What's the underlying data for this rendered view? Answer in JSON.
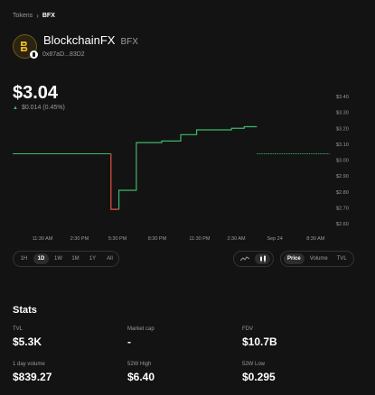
{
  "breadcrumb": {
    "parent": "Tokens",
    "separator": "›",
    "current": "BFX"
  },
  "token": {
    "name": "BlockchainFX",
    "symbol": "BFX",
    "address": "0x87aD...83D2",
    "logo_icon": "bfx-logo-icon"
  },
  "price": {
    "value": "$3.04",
    "change": "$0.014 (0.45%)",
    "direction": "up"
  },
  "chart_data": {
    "type": "line",
    "x_tick_labels": [
      "11:30 AM",
      "2:30 PM",
      "5:30 PM",
      "8:30 PM",
      "11:30 PM",
      "2:30 AM",
      "Sep 24",
      "8:30 AM"
    ],
    "y_tick_labels": [
      "$3.40",
      "$3.30",
      "$3.20",
      "$3.10",
      "$3.00",
      "$2.90",
      "$2.80",
      "$2.70",
      "$2.60"
    ],
    "ylim": [
      2.6,
      3.4
    ],
    "series": [
      {
        "values_by_index": "see points",
        "color": "#40b66b"
      }
    ],
    "points": [
      {
        "t": 0.0,
        "v": 3.04
      },
      {
        "t": 0.31,
        "v": 3.04
      },
      {
        "t": 0.31,
        "v": 2.69
      },
      {
        "t": 0.335,
        "v": 2.69
      },
      {
        "t": 0.335,
        "v": 2.81
      },
      {
        "t": 0.39,
        "v": 2.81
      },
      {
        "t": 0.39,
        "v": 3.11
      },
      {
        "t": 0.47,
        "v": 3.11
      },
      {
        "t": 0.47,
        "v": 3.12
      },
      {
        "t": 0.53,
        "v": 3.12
      },
      {
        "t": 0.53,
        "v": 3.16
      },
      {
        "t": 0.58,
        "v": 3.16
      },
      {
        "t": 0.58,
        "v": 3.19
      },
      {
        "t": 0.69,
        "v": 3.19
      },
      {
        "t": 0.69,
        "v": 3.2
      },
      {
        "t": 0.73,
        "v": 3.2
      },
      {
        "t": 0.73,
        "v": 3.21
      },
      {
        "t": 0.77,
        "v": 3.21
      }
    ],
    "dashed_segment": {
      "t_start": 0.77,
      "t_end": 1.0,
      "v": 3.04
    },
    "down_segment": {
      "t_start": 0.31,
      "t_end": 0.335,
      "color": "#e5533b"
    },
    "line_color": "#40b66b"
  },
  "time_ranges": [
    "1H",
    "1D",
    "1W",
    "1M",
    "1Y",
    "All"
  ],
  "time_range_selected": "1D",
  "chart_types": [
    "line-chart-icon",
    "candlestick-icon"
  ],
  "chart_type_selected": "candlestick-icon",
  "views": [
    "Price",
    "Volume",
    "TVL"
  ],
  "view_selected": "Price",
  "stats": {
    "title": "Stats",
    "items": [
      {
        "label": "TVL",
        "value": "$5.3K"
      },
      {
        "label": "Market cap",
        "value": "-"
      },
      {
        "label": "FDV",
        "value": "$10.7B"
      },
      {
        "label": "1 day volume",
        "value": "$839.27"
      },
      {
        "label": "52W High",
        "value": "$6.40"
      },
      {
        "label": "52W Low",
        "value": "$0.295"
      }
    ]
  }
}
